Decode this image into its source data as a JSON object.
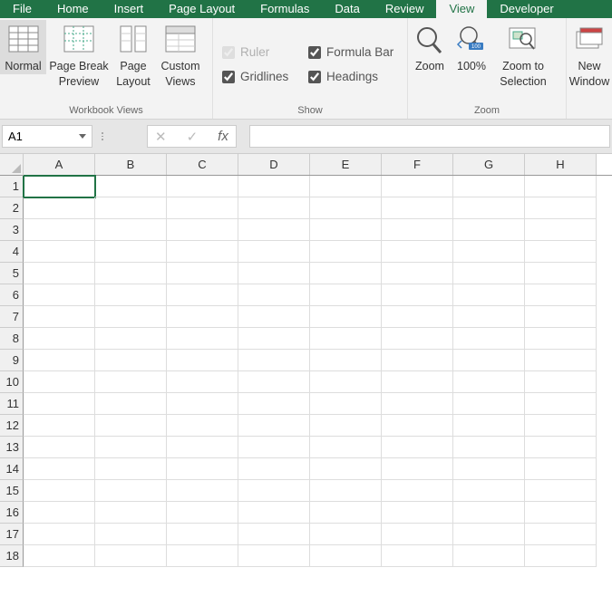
{
  "menu": {
    "tabs": [
      "File",
      "Home",
      "Insert",
      "Page Layout",
      "Formulas",
      "Data",
      "Review",
      "View",
      "Developer"
    ],
    "active": "View"
  },
  "ribbon": {
    "workbook_views": {
      "label": "Workbook Views",
      "normal": "Normal",
      "page_break": "Page Break\nPreview",
      "page_layout": "Page\nLayout",
      "custom_views": "Custom\nViews"
    },
    "show": {
      "label": "Show",
      "ruler": "Ruler",
      "formula_bar": "Formula Bar",
      "gridlines": "Gridlines",
      "headings": "Headings"
    },
    "zoom": {
      "label": "Zoom",
      "zoom": "Zoom",
      "hundred": "100%",
      "zoom_to_selection": "Zoom to\nSelection"
    },
    "window": {
      "new_window": "New\nWindow"
    }
  },
  "formula_bar": {
    "name_box_value": "A1",
    "fx": "fx",
    "formula_value": ""
  },
  "grid": {
    "columns": [
      "A",
      "B",
      "C",
      "D",
      "E",
      "F",
      "G",
      "H"
    ],
    "rows": [
      1,
      2,
      3,
      4,
      5,
      6,
      7,
      8,
      9,
      10,
      11,
      12,
      13,
      14,
      15,
      16,
      17,
      18
    ],
    "active_cell": "A1"
  }
}
